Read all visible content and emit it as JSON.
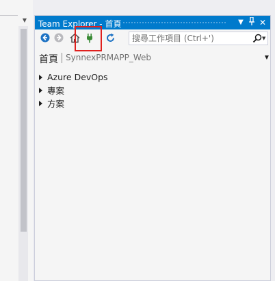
{
  "window": {
    "title": "Team Explorer - 首頁",
    "buttons": {
      "dropdown": "▼",
      "pin": "⊥",
      "close": "✕"
    }
  },
  "toolbar": {
    "back_icon": "back-arrow-icon",
    "forward_icon": "forward-arrow-icon",
    "home_icon": "home-icon",
    "connect_icon": "plug-icon",
    "refresh_icon": "refresh-icon",
    "search_placeholder": "搜尋工作項目 (Ctrl+')",
    "search_value": ""
  },
  "page": {
    "title": "首頁",
    "repo": "SynnexPRMAPP_Web"
  },
  "sections": [
    {
      "label": "Azure DevOps"
    },
    {
      "label": "專案"
    },
    {
      "label": "方案"
    }
  ],
  "colors": {
    "title_bar": "#007acc",
    "highlight": "#e0201e",
    "icon_blue": "#1e73c4",
    "icon_green": "#388a34"
  }
}
